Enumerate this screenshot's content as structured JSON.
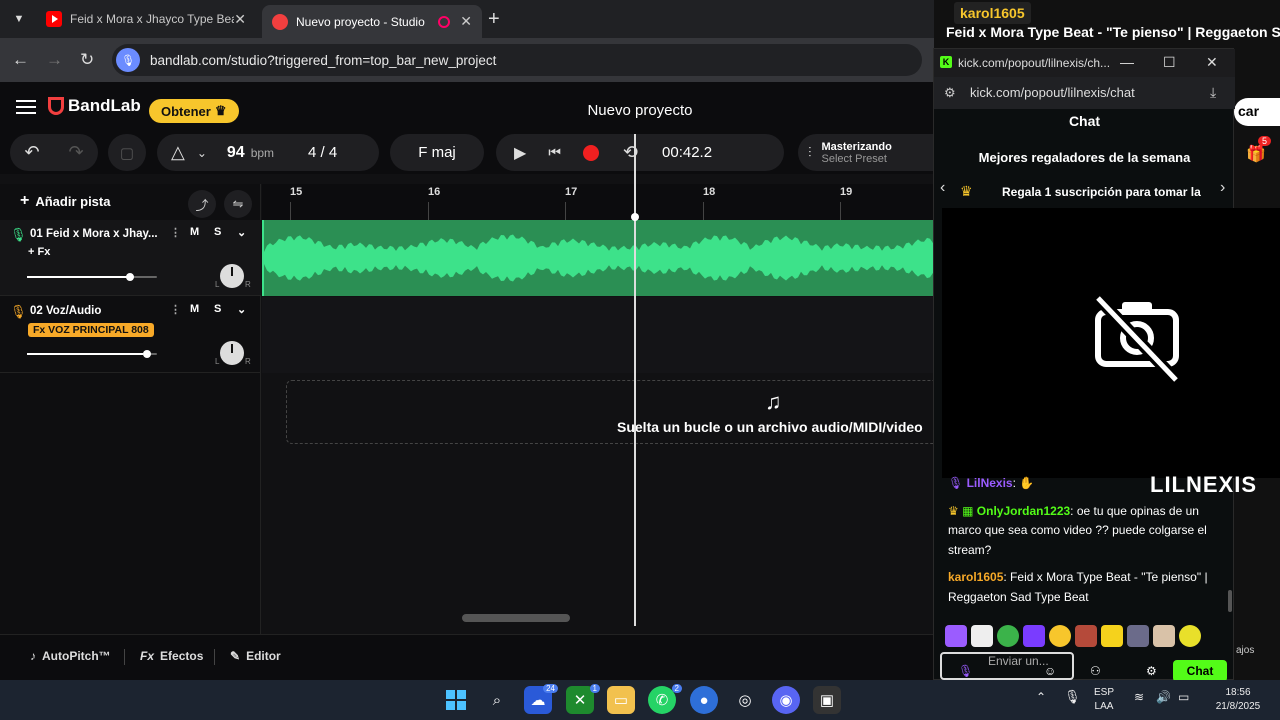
{
  "browser": {
    "tabs": [
      {
        "title": "Feid x Mora x Jhayco Type Beat"
      },
      {
        "title": "Nuevo proyecto - Studio"
      }
    ],
    "url": "bandlab.com/studio?triggered_from=top_bar_new_project"
  },
  "app": {
    "brand": "BandLab",
    "obtener_label": "Obtener",
    "project_title": "Nuevo proyecto",
    "tempo": "94",
    "tempo_unit": "bpm",
    "time_sig_num": "4",
    "time_sig_den": "4",
    "key": "F maj",
    "time": "00:42.2",
    "mastering_title": "Masterizando",
    "mastering_preset": "Select Preset",
    "add_track": "Añadir pista",
    "ruler_ticks": [
      "15",
      "16",
      "17",
      "18",
      "19"
    ],
    "tracks": [
      {
        "name": "01  Feid x Mora x Jhay...",
        "fx": "+ Fx",
        "volume": 0.79
      },
      {
        "name": "02  Voz/Audio",
        "fx": "Fx VOZ PRINCIPAL 808",
        "volume": 0.89
      }
    ],
    "mute_label": "M",
    "solo_label": "S",
    "pan_left": "L",
    "pan_right": "R",
    "drop_text": "Suelta un bucle o un archivo audio/MIDI/video",
    "bottom": {
      "autopitch": "AutoPitch™",
      "fx_prefix": "Fx",
      "effects": "Efectos",
      "editor": "Editor"
    },
    "accent": "#f7c62c",
    "wave_color": "#3de28a"
  },
  "stream": {
    "user": "karol1605",
    "title": "Feid x Mora Type Beat - \"Te pienso\" | Reggaeton Sad Type Beat",
    "right_partial_label": "car",
    "notif_count": "5",
    "right_partial_bottom": "ajos"
  },
  "popup": {
    "title": "kick.com/popout/lilnexis/ch...",
    "url": "kick.com/popout/lilnexis/chat",
    "chat_label": "Chat",
    "gifters_title": "Mejores regaladores de la semana",
    "gift_line": "Regala 1 suscripción para tomar la",
    "streamer_name": "LILNEXIS",
    "messages": [
      {
        "user": "LilNexis",
        "text": ":",
        "color": "#9b5cff"
      },
      {
        "user": "OnlyJordan1223",
        "text": ": oe tu que opinas de un marco que sea como video ?? puede colgarse el stream?",
        "color": "#53fc18"
      },
      {
        "user": "karol1605",
        "text": ": Feid x Mora Type Beat - \"Te pienso\" | Reggaeton Sad Type Beat",
        "color": "#f7a928"
      }
    ],
    "send_placeholder": "Enviar un...",
    "chat_button": "Chat",
    "kick_color": "#53fc18"
  },
  "taskbar": {
    "badges": {
      "widgets": "24",
      "xbox": "1",
      "whatsapp": "2"
    },
    "lang_top": "ESP",
    "lang_bottom": "LAA",
    "time": "18:56",
    "date": "21/8/2025"
  }
}
